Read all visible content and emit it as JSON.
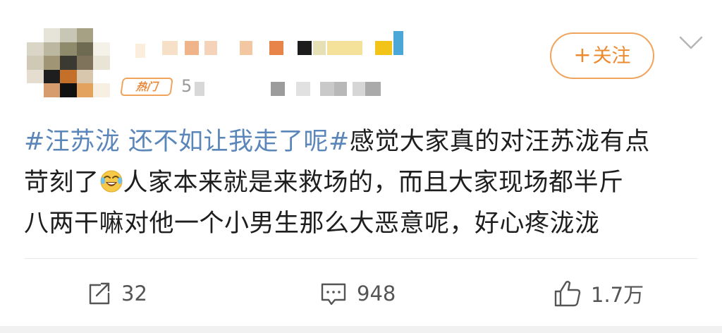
{
  "post": {
    "follower_count": "5",
    "hot_badge": "热门",
    "follow_label": "关注",
    "text_hashtag": "#汪苏泷 还不如让我走了呢#",
    "text_line1_rest": "感觉大家真的对汪苏泷有点",
    "text_line2_a": "苛刻了",
    "text_line2_b": "人家本来就是来救场的，而且大家现场都半斤",
    "text_line3": "八两干嘛对他一个小男生那么大恶意呢，好心疼泷泷"
  },
  "actions": {
    "repost_count": "32",
    "comment_count": "948",
    "like_count": "1.7万"
  },
  "icons": {
    "repost": "repost-icon",
    "comment": "comment-icon",
    "like": "like-icon",
    "chevron": "chevron-down-icon",
    "emoji": "laughing-crying-emoji"
  },
  "colors": {
    "accent": "#ec8a2e",
    "hashtag": "#5b86ba",
    "text": "#1e1e1e",
    "muted": "#555555"
  }
}
